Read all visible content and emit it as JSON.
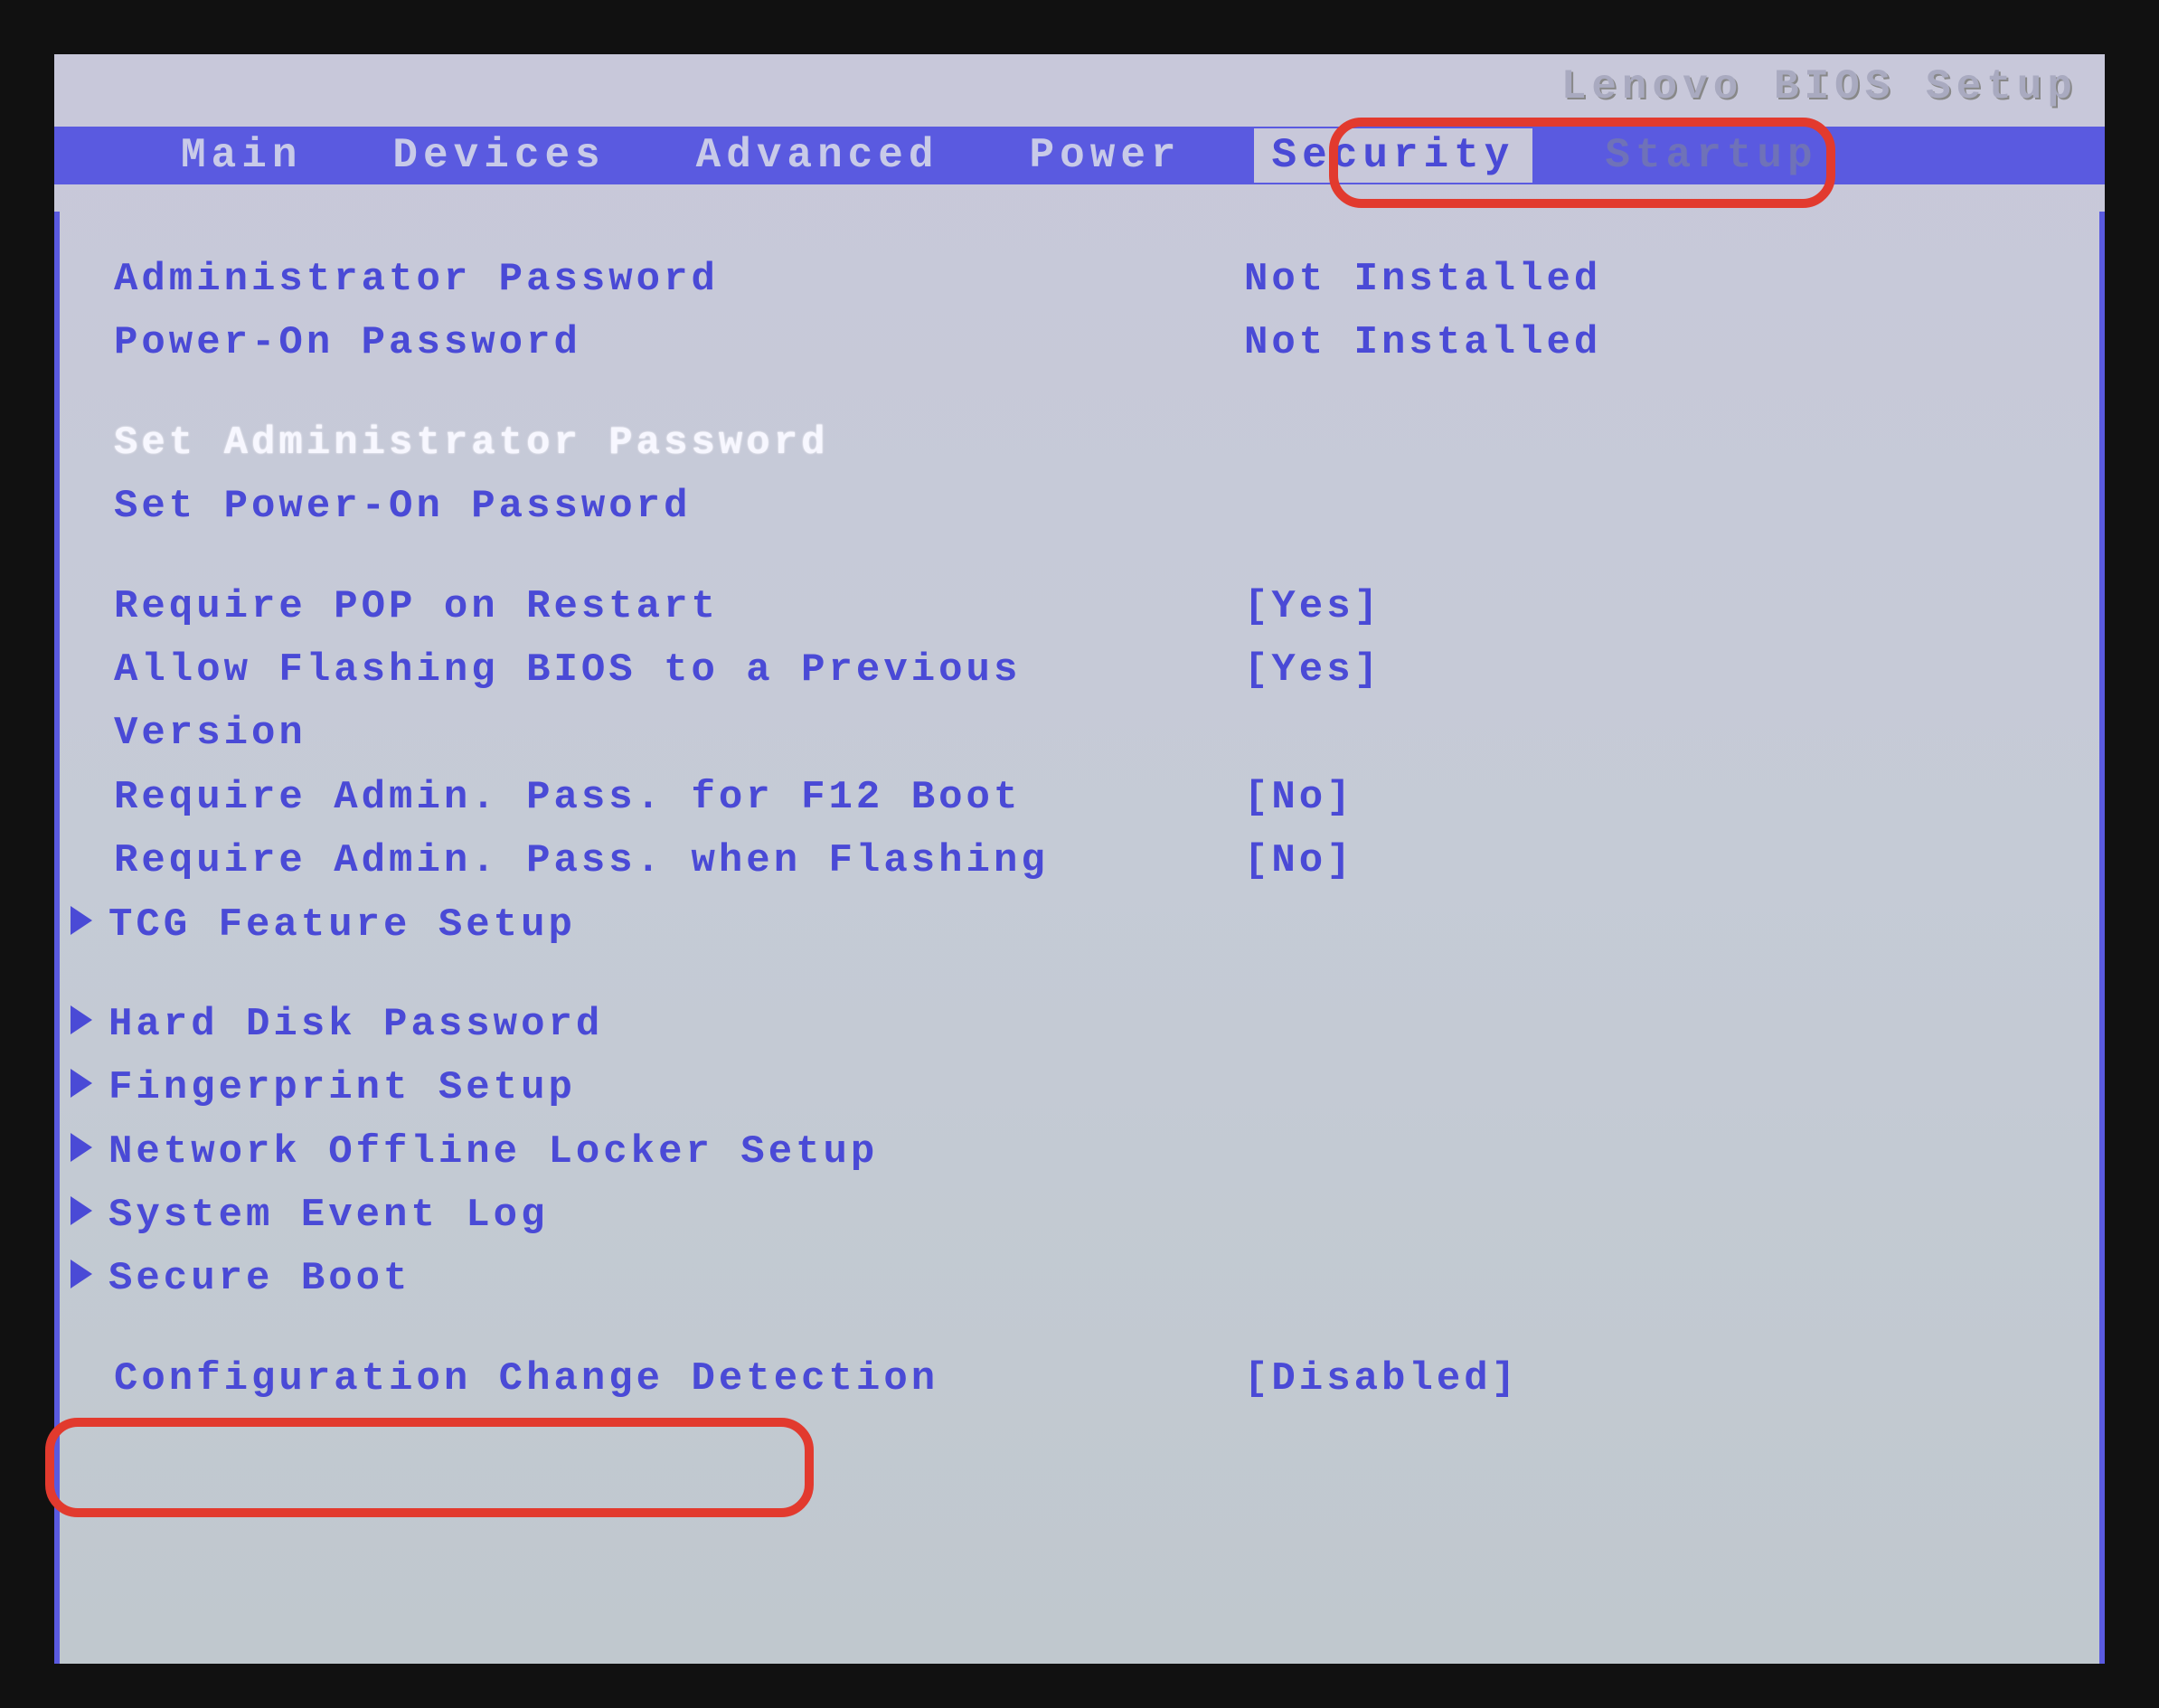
{
  "header": {
    "title": "Lenovo BIOS Setup"
  },
  "tabs": [
    {
      "label": "Main"
    },
    {
      "label": "Devices"
    },
    {
      "label": "Advanced"
    },
    {
      "label": "Power"
    },
    {
      "label": "Security"
    },
    {
      "label": "Startup"
    }
  ],
  "security": {
    "admin_pwd": {
      "label": "Administrator Password",
      "value": "Not Installed"
    },
    "pop_pwd": {
      "label": "Power-On Password",
      "value": "Not Installed"
    },
    "set_admin": "Set Administrator Password",
    "set_pop": "Set Power-On Password",
    "require_pop_restart": {
      "label": "Require POP on Restart",
      "value": "[Yes]"
    },
    "allow_flash_prev": {
      "label": "Allow Flashing BIOS to a Previous",
      "label2": "Version",
      "value": "[Yes]"
    },
    "require_admin_f12": {
      "label": "Require Admin. Pass. for F12 Boot",
      "value": "[No]"
    },
    "require_admin_flashing": {
      "label": "Require Admin. Pass. when Flashing",
      "value": "[No]"
    },
    "tcg": "TCG Feature Setup",
    "hdd_pwd": "Hard Disk Password",
    "fingerprint": "Fingerprint Setup",
    "net_locker": "Network Offline Locker Setup",
    "sys_event": "System Event Log",
    "secure_boot": "Secure Boot",
    "cfg_change_detect": {
      "label": "Configuration Change Detection",
      "value": "[Disabled]"
    }
  }
}
